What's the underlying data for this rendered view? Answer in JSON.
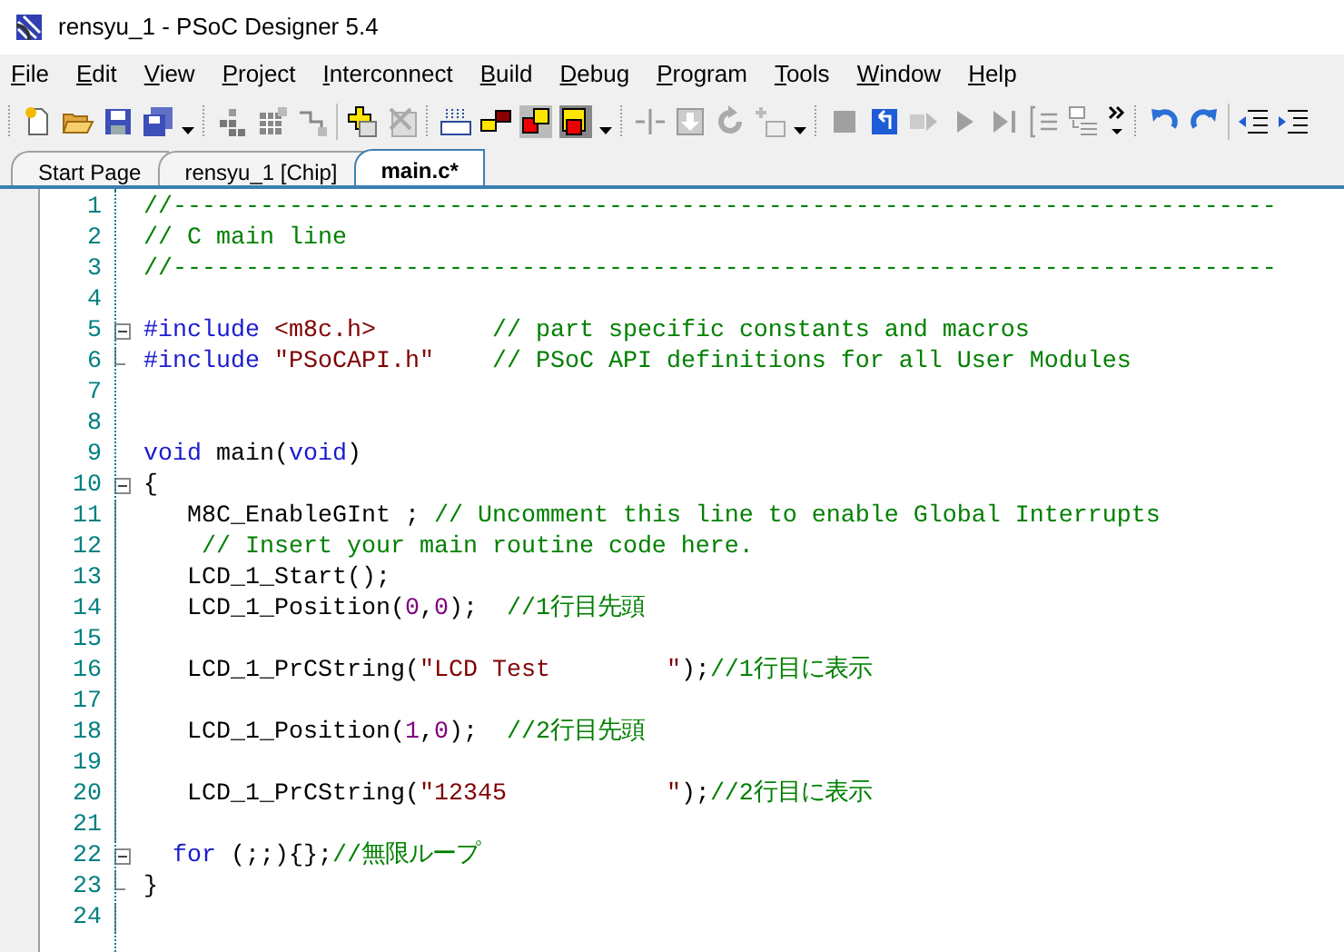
{
  "window": {
    "title": "rensyu_1 - PSoC Designer 5.4"
  },
  "menu": [
    "File",
    "Edit",
    "View",
    "Project",
    "Interconnect",
    "Build",
    "Debug",
    "Program",
    "Tools",
    "Window",
    "Help"
  ],
  "tabs": [
    {
      "label": "Start Page",
      "selected": false
    },
    {
      "label": "rensyu_1 [Chip]",
      "selected": false
    },
    {
      "label": "main.c*",
      "selected": true
    }
  ],
  "editor": {
    "lines": [
      {
        "number": "1",
        "fold_start": false,
        "fold_end": false,
        "segments": [
          {
            "kind": "comment",
            "text": "//----------------------------------------------------------------------------"
          }
        ]
      },
      {
        "number": "2",
        "fold_start": false,
        "fold_end": false,
        "segments": [
          {
            "kind": "comment",
            "text": "// C main line"
          }
        ]
      },
      {
        "number": "3",
        "fold_start": false,
        "fold_end": false,
        "segments": [
          {
            "kind": "comment",
            "text": "//----------------------------------------------------------------------------"
          }
        ]
      },
      {
        "number": "4",
        "fold_start": false,
        "fold_end": false
      },
      {
        "number": "5",
        "fold_start": true,
        "fold_end": false,
        "segments": [
          {
            "kind": "keyword",
            "text": "#include "
          },
          {
            "kind": "string",
            "text": "<m8c.h>        "
          },
          {
            "kind": "comment",
            "text": "// part specific constants and macros"
          }
        ]
      },
      {
        "number": "6",
        "fold_start": false,
        "fold_end": true,
        "segments": [
          {
            "kind": "keyword",
            "text": "#include "
          },
          {
            "kind": "string",
            "text": "\"PSoCAPI.h\"    "
          },
          {
            "kind": "comment",
            "text": "// PSoC API definitions for all User Modules"
          }
        ]
      },
      {
        "number": "7",
        "fold_start": false,
        "fold_end": false
      },
      {
        "number": "8",
        "fold_start": false,
        "fold_end": false
      },
      {
        "number": "9",
        "fold_start": false,
        "fold_end": false,
        "segments": [
          {
            "kind": "keyword",
            "text": "void"
          },
          {
            "kind": "plain",
            "text": " main("
          },
          {
            "kind": "keyword",
            "text": "void"
          },
          {
            "kind": "plain",
            "text": ")"
          }
        ]
      },
      {
        "number": "10",
        "fold_start": true,
        "fold_end": false,
        "segments": [
          {
            "kind": "plain",
            "text": "{"
          }
        ]
      },
      {
        "number": "11",
        "fold_start": false,
        "fold_end": false,
        "segments": [
          {
            "kind": "plain",
            "text": "   M8C_EnableGInt ; "
          },
          {
            "kind": "comment",
            "text": "// Uncomment this line to enable Global Interrupts"
          }
        ]
      },
      {
        "number": "12",
        "fold_start": false,
        "fold_end": false,
        "segments": [
          {
            "kind": "comment",
            "text": "    // Insert your main routine code here."
          }
        ]
      },
      {
        "number": "13",
        "fold_start": false,
        "fold_end": false,
        "segments": [
          {
            "kind": "plain",
            "text": "   LCD_1_Start();"
          }
        ]
      },
      {
        "number": "14",
        "fold_start": false,
        "fold_end": false,
        "segments": [
          {
            "kind": "plain",
            "text": "   LCD_1_Position("
          },
          {
            "kind": "number",
            "text": "0"
          },
          {
            "kind": "plain",
            "text": ","
          },
          {
            "kind": "number",
            "text": "0"
          },
          {
            "kind": "plain",
            "text": ");  "
          },
          {
            "kind": "comment",
            "text": "//1行目先頭"
          }
        ]
      },
      {
        "number": "15",
        "fold_start": false,
        "fold_end": false
      },
      {
        "number": "16",
        "fold_start": false,
        "fold_end": false,
        "segments": [
          {
            "kind": "plain",
            "text": "   LCD_1_PrCString("
          },
          {
            "kind": "string",
            "text": "\"LCD Test        \""
          },
          {
            "kind": "plain",
            "text": ");"
          },
          {
            "kind": "comment",
            "text": "//1行目に表示"
          }
        ]
      },
      {
        "number": "17",
        "fold_start": false,
        "fold_end": false
      },
      {
        "number": "18",
        "fold_start": false,
        "fold_end": false,
        "segments": [
          {
            "kind": "plain",
            "text": "   LCD_1_Position("
          },
          {
            "kind": "number",
            "text": "1"
          },
          {
            "kind": "plain",
            "text": ","
          },
          {
            "kind": "number",
            "text": "0"
          },
          {
            "kind": "plain",
            "text": ");  "
          },
          {
            "kind": "comment",
            "text": "//2行目先頭"
          }
        ]
      },
      {
        "number": "19",
        "fold_start": false,
        "fold_end": false
      },
      {
        "number": "20",
        "fold_start": false,
        "fold_end": false,
        "segments": [
          {
            "kind": "plain",
            "text": "   LCD_1_PrCString("
          },
          {
            "kind": "string",
            "text": "\"12345           \""
          },
          {
            "kind": "plain",
            "text": ");"
          },
          {
            "kind": "comment",
            "text": "//2行目に表示"
          }
        ]
      },
      {
        "number": "21",
        "fold_start": false,
        "fold_end": false
      },
      {
        "number": "22",
        "fold_start": true,
        "fold_end": false,
        "segments": [
          {
            "kind": "keyword",
            "text": "  for"
          },
          {
            "kind": "plain",
            "text": " (;;){};"
          },
          {
            "kind": "comment",
            "text": "//無限ループ"
          }
        ]
      },
      {
        "number": "23",
        "fold_start": false,
        "fold_end": true,
        "segments": [
          {
            "kind": "plain",
            "text": "}"
          }
        ]
      },
      {
        "number": "24",
        "fold_start": false,
        "fold_end": false
      }
    ]
  }
}
